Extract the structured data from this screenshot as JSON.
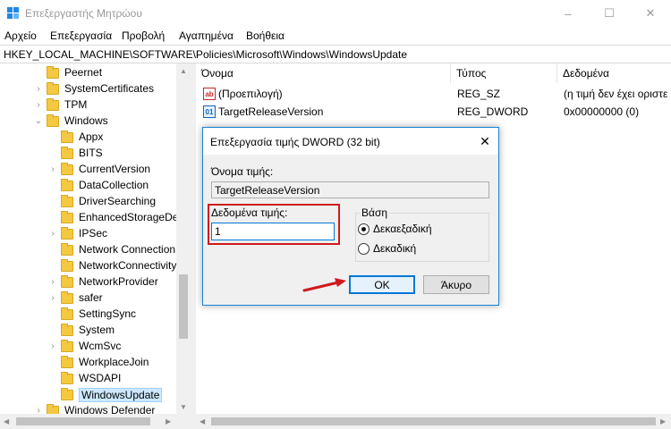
{
  "window": {
    "title": "Επεξεργαστής Μητρώου",
    "minimize": "–",
    "maximize": "☐",
    "close": "✕"
  },
  "menu": [
    "Αρχείο",
    "Επεξεργασία",
    "Προβολή",
    "Αγαπημένα",
    "Βοήθεια"
  ],
  "address": "HKEY_LOCAL_MACHINE\\SOFTWARE\\Policies\\Microsoft\\Windows\\WindowsUpdate",
  "tree": {
    "items": [
      {
        "label": "Peernet",
        "chevron": ""
      },
      {
        "label": "SystemCertificates",
        "chevron": "›"
      },
      {
        "label": "TPM",
        "chevron": "›"
      },
      {
        "label": "Windows",
        "chevron": "⌄"
      },
      {
        "label": "Appx",
        "chevron": ""
      },
      {
        "label": "BITS",
        "chevron": ""
      },
      {
        "label": "CurrentVersion",
        "chevron": "›"
      },
      {
        "label": "DataCollection",
        "chevron": ""
      },
      {
        "label": "DriverSearching",
        "chevron": ""
      },
      {
        "label": "EnhancedStorageDe",
        "chevron": ""
      },
      {
        "label": "IPSec",
        "chevron": "›"
      },
      {
        "label": "Network Connection",
        "chevron": ""
      },
      {
        "label": "NetworkConnectivity",
        "chevron": ""
      },
      {
        "label": "NetworkProvider",
        "chevron": "›"
      },
      {
        "label": "safer",
        "chevron": "›"
      },
      {
        "label": "SettingSync",
        "chevron": ""
      },
      {
        "label": "System",
        "chevron": ""
      },
      {
        "label": "WcmSvc",
        "chevron": "›"
      },
      {
        "label": "WorkplaceJoin",
        "chevron": ""
      },
      {
        "label": "WSDAPI",
        "chevron": ""
      },
      {
        "label": "WindowsUpdate",
        "chevron": ""
      },
      {
        "label": "Windows Defender",
        "chevron": "›"
      }
    ],
    "selected": "WindowsUpdate"
  },
  "list": {
    "columns": [
      "Όνομα",
      "Τύπος",
      "Δεδομένα"
    ],
    "rows": [
      {
        "name": "(Προεπιλογή)",
        "type": "REG_SZ",
        "data": "(η τιμή δεν έχει οριστε",
        "icon": "ab"
      },
      {
        "name": "TargetReleaseVersion",
        "type": "REG_DWORD",
        "data": "0x00000000 (0)",
        "icon": "01"
      }
    ]
  },
  "dialog": {
    "title": "Επεξεργασία τιμής DWORD (32 bit)",
    "close": "✕",
    "name_label": "Όνομα τιμής:",
    "name_value": "TargetReleaseVersion",
    "value_label": "Δεδομένα τιμής:",
    "value_value": "1",
    "basis_label": "Βάση",
    "radio_hex": "Δεκαεξαδική",
    "radio_dec": "Δεκαδική",
    "selected_basis": "Δεκαεξαδική",
    "ok": "OK",
    "cancel": "Άκυρο"
  },
  "colors": {
    "accent": "#0078d7",
    "highlight": "#d0191c",
    "folder": "#f5c842",
    "selection": "#cde8ff"
  }
}
